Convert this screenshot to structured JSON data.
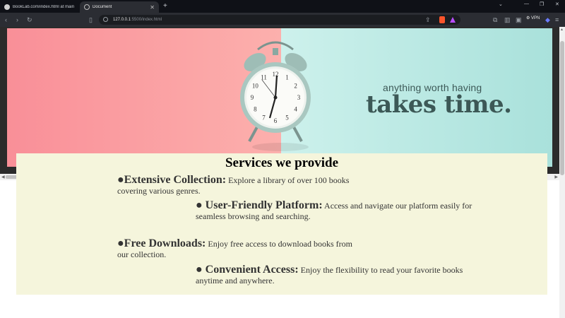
{
  "browser": {
    "tabs": [
      {
        "title": "BookLab.com/index.html at main · A",
        "active": false
      },
      {
        "title": "Document",
        "active": true
      }
    ],
    "address": {
      "host": "127.0.0.1",
      "rest": ":5500/index.html"
    },
    "vpn_label": "VPN"
  },
  "hero": {
    "tagline_small": "anything worth having",
    "tagline_big": "takes time.",
    "colors": {
      "left": "#f98f98",
      "right": "#a9e1db",
      "text": "#3c5856"
    }
  },
  "services": {
    "title": "Services we provide",
    "background": "#f5f5dc",
    "items": [
      {
        "bullet": "●",
        "heading": "Extensive Collection:",
        "text": " Explore a library of over 100 books covering various genres."
      },
      {
        "bullet": "● ",
        "heading": "User-Friendly Platform:",
        "text": " Access and navigate our platform easily for seamless browsing and searching."
      },
      {
        "bullet": "●",
        "heading": "Free Downloads:",
        "text": " Enjoy free access to download books from our collection."
      },
      {
        "bullet": "● ",
        "heading": "Convenient Access:",
        "text": " Enjoy the flexibility to read your favorite books anytime and anywhere."
      }
    ]
  },
  "clock_numbers": [
    "12",
    "1",
    "2",
    "3",
    "4",
    "5",
    "6",
    "7",
    "8",
    "9",
    "10",
    "11"
  ]
}
